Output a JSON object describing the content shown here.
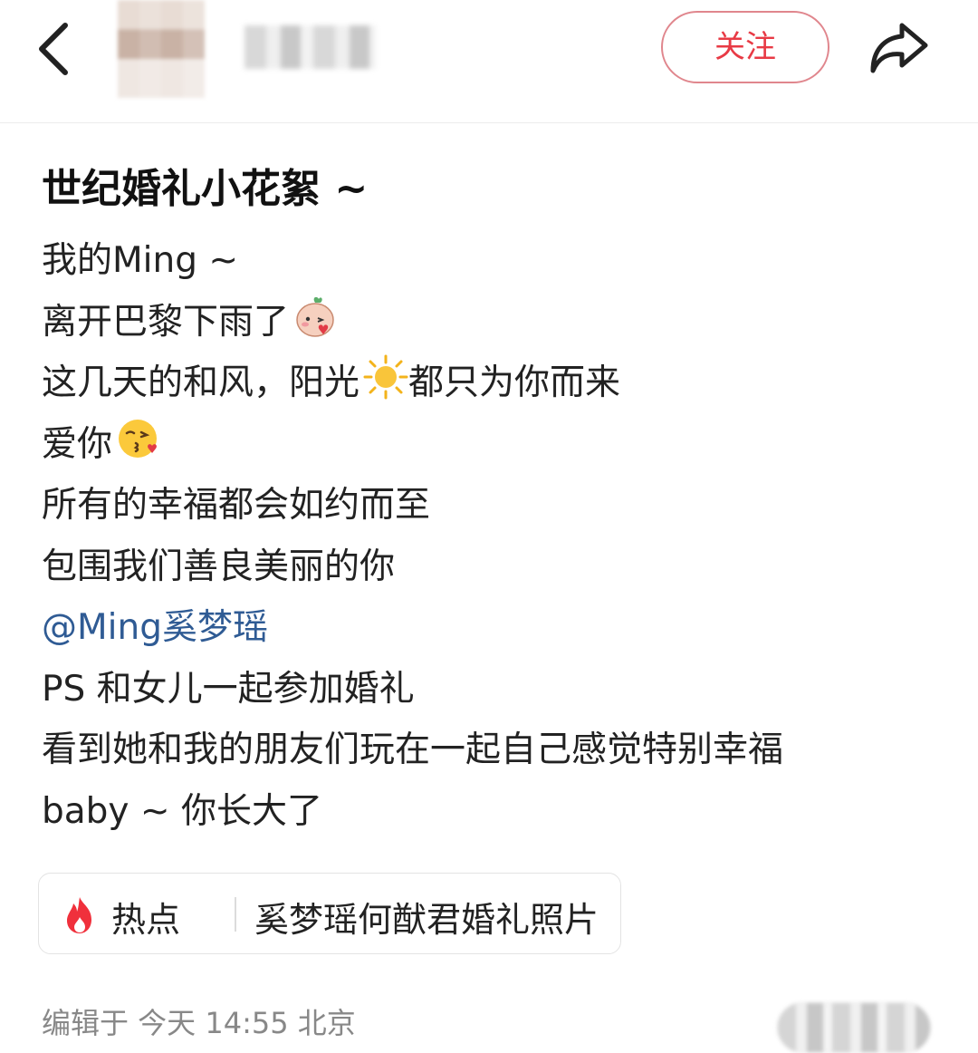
{
  "header": {
    "follow_label": "关注",
    "back_icon": "chevron-left-icon",
    "share_icon": "share-arrow-icon"
  },
  "post": {
    "title": "世纪婚礼小花絮 ~",
    "lines": [
      "我的Ming ~",
      "离开巴黎下雨了",
      "这几天的和风，阳光",
      "都只为你而来",
      "爱你",
      "所有的幸福都会如约而至",
      "包围我们善良美丽的你",
      "@Ming奚梦瑶",
      "PS 和女儿一起参加婚礼",
      "看到她和我的朋友们玩在一起自己感觉特别幸福",
      "baby ~ 你长大了"
    ],
    "emojis": [
      "peach-blush-emoji",
      "sun-emoji",
      "kiss-emoji"
    ]
  },
  "hot": {
    "label": "热点",
    "topic": "奚梦瑶何猷君婚礼照片",
    "icon": "fire-icon"
  },
  "meta": {
    "edited": "编辑于  今天 14:55  北京"
  },
  "colors": {
    "follow": "#e83a45",
    "mention": "#2f5b94",
    "fire": "#f0303c"
  }
}
